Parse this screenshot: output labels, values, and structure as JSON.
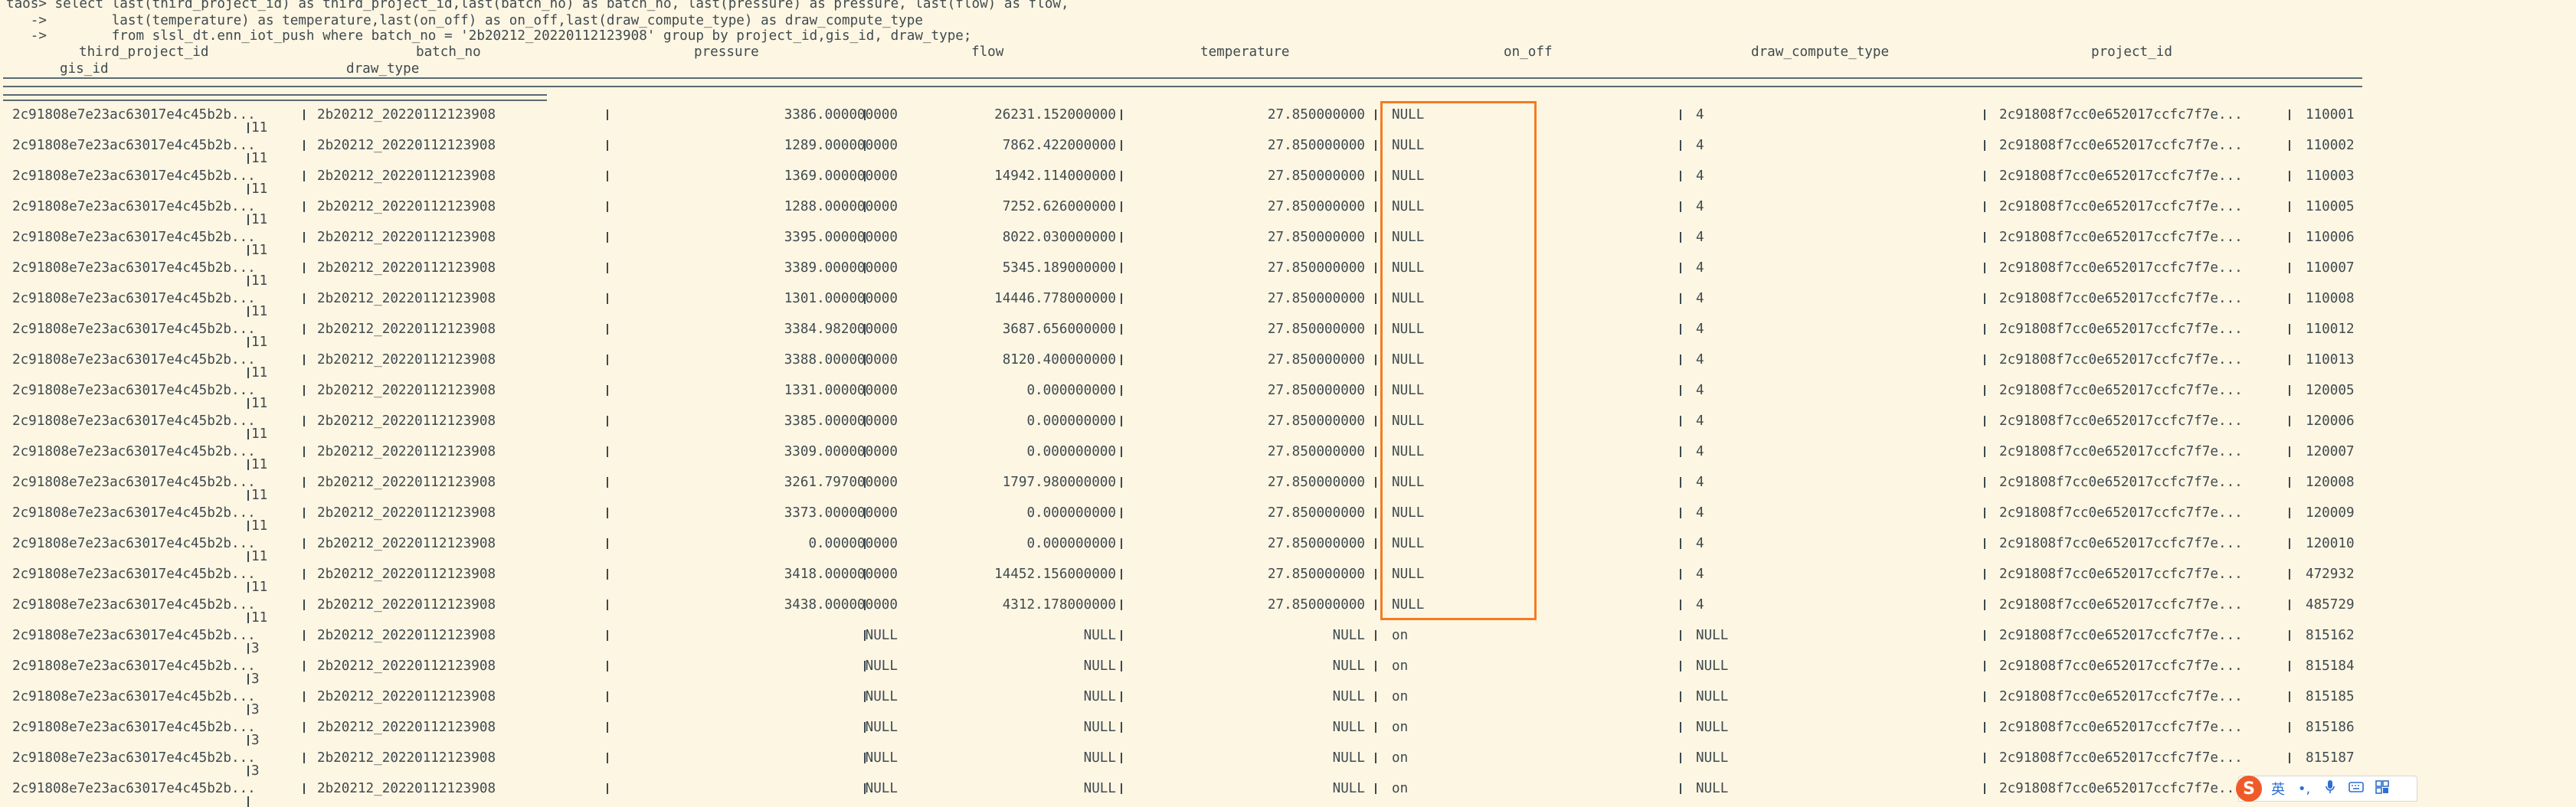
{
  "prompt": {
    "line1": "taos> select last(third_project_id) as third_project_id,last(batch_no) as batch_no, last(pressure) as pressure, last(flow) as flow,",
    "line2": "   ->        last(temperature) as temperature,last(on_off) as on_off,last(draw_compute_type) as draw_compute_type",
    "line3": "   ->        from slsl_dt.enn_iot_push where batch_no = '2b20212_20220112123908' group by project_id,gis_id, draw_type;"
  },
  "header": {
    "third_project_id": "third_project_id",
    "batch_no": "batch_no",
    "pressure": "pressure",
    "flow": "flow",
    "temperature": "temperature",
    "on_off": "on_off",
    "draw_compute_type": "draw_compute_type",
    "project_id": "project_id",
    "gis_id": "gis_id",
    "draw_type": "draw_type"
  },
  "rows": [
    {
      "third_project_id": "2c91808e7e23ac63017e4c45b2b...",
      "batch_no": "2b20212_20220112123908",
      "pressure": "3386.000000000",
      "flow": "26231.152000000",
      "temperature": "27.850000000",
      "on_off": "NULL",
      "draw_compute_type": "4",
      "project_id": "2c91808f7cc0e652017ccfc7f7e...",
      "gis_id": "110001",
      "draw_type": "11"
    },
    {
      "third_project_id": "2c91808e7e23ac63017e4c45b2b...",
      "batch_no": "2b20212_20220112123908",
      "pressure": "1289.000000000",
      "flow": "7862.422000000",
      "temperature": "27.850000000",
      "on_off": "NULL",
      "draw_compute_type": "4",
      "project_id": "2c91808f7cc0e652017ccfc7f7e...",
      "gis_id": "110002",
      "draw_type": "11"
    },
    {
      "third_project_id": "2c91808e7e23ac63017e4c45b2b...",
      "batch_no": "2b20212_20220112123908",
      "pressure": "1369.000000000",
      "flow": "14942.114000000",
      "temperature": "27.850000000",
      "on_off": "NULL",
      "draw_compute_type": "4",
      "project_id": "2c91808f7cc0e652017ccfc7f7e...",
      "gis_id": "110003",
      "draw_type": "11"
    },
    {
      "third_project_id": "2c91808e7e23ac63017e4c45b2b...",
      "batch_no": "2b20212_20220112123908",
      "pressure": "1288.000000000",
      "flow": "7252.626000000",
      "temperature": "27.850000000",
      "on_off": "NULL",
      "draw_compute_type": "4",
      "project_id": "2c91808f7cc0e652017ccfc7f7e...",
      "gis_id": "110005",
      "draw_type": "11"
    },
    {
      "third_project_id": "2c91808e7e23ac63017e4c45b2b...",
      "batch_no": "2b20212_20220112123908",
      "pressure": "3395.000000000",
      "flow": "8022.030000000",
      "temperature": "27.850000000",
      "on_off": "NULL",
      "draw_compute_type": "4",
      "project_id": "2c91808f7cc0e652017ccfc7f7e...",
      "gis_id": "110006",
      "draw_type": "11"
    },
    {
      "third_project_id": "2c91808e7e23ac63017e4c45b2b...",
      "batch_no": "2b20212_20220112123908",
      "pressure": "3389.000000000",
      "flow": "5345.189000000",
      "temperature": "27.850000000",
      "on_off": "NULL",
      "draw_compute_type": "4",
      "project_id": "2c91808f7cc0e652017ccfc7f7e...",
      "gis_id": "110007",
      "draw_type": "11"
    },
    {
      "third_project_id": "2c91808e7e23ac63017e4c45b2b...",
      "batch_no": "2b20212_20220112123908",
      "pressure": "1301.000000000",
      "flow": "14446.778000000",
      "temperature": "27.850000000",
      "on_off": "NULL",
      "draw_compute_type": "4",
      "project_id": "2c91808f7cc0e652017ccfc7f7e...",
      "gis_id": "110008",
      "draw_type": "11"
    },
    {
      "third_project_id": "2c91808e7e23ac63017e4c45b2b...",
      "batch_no": "2b20212_20220112123908",
      "pressure": "3384.982000000",
      "flow": "3687.656000000",
      "temperature": "27.850000000",
      "on_off": "NULL",
      "draw_compute_type": "4",
      "project_id": "2c91808f7cc0e652017ccfc7f7e...",
      "gis_id": "110012",
      "draw_type": "11"
    },
    {
      "third_project_id": "2c91808e7e23ac63017e4c45b2b...",
      "batch_no": "2b20212_20220112123908",
      "pressure": "3388.000000000",
      "flow": "8120.400000000",
      "temperature": "27.850000000",
      "on_off": "NULL",
      "draw_compute_type": "4",
      "project_id": "2c91808f7cc0e652017ccfc7f7e...",
      "gis_id": "110013",
      "draw_type": "11"
    },
    {
      "third_project_id": "2c91808e7e23ac63017e4c45b2b...",
      "batch_no": "2b20212_20220112123908",
      "pressure": "1331.000000000",
      "flow": "0.000000000",
      "temperature": "27.850000000",
      "on_off": "NULL",
      "draw_compute_type": "4",
      "project_id": "2c91808f7cc0e652017ccfc7f7e...",
      "gis_id": "120005",
      "draw_type": "11"
    },
    {
      "third_project_id": "2c91808e7e23ac63017e4c45b2b...",
      "batch_no": "2b20212_20220112123908",
      "pressure": "3385.000000000",
      "flow": "0.000000000",
      "temperature": "27.850000000",
      "on_off": "NULL",
      "draw_compute_type": "4",
      "project_id": "2c91808f7cc0e652017ccfc7f7e...",
      "gis_id": "120006",
      "draw_type": "11"
    },
    {
      "third_project_id": "2c91808e7e23ac63017e4c45b2b...",
      "batch_no": "2b20212_20220112123908",
      "pressure": "3309.000000000",
      "flow": "0.000000000",
      "temperature": "27.850000000",
      "on_off": "NULL",
      "draw_compute_type": "4",
      "project_id": "2c91808f7cc0e652017ccfc7f7e...",
      "gis_id": "120007",
      "draw_type": "11"
    },
    {
      "third_project_id": "2c91808e7e23ac63017e4c45b2b...",
      "batch_no": "2b20212_20220112123908",
      "pressure": "3261.797000000",
      "flow": "1797.980000000",
      "temperature": "27.850000000",
      "on_off": "NULL",
      "draw_compute_type": "4",
      "project_id": "2c91808f7cc0e652017ccfc7f7e...",
      "gis_id": "120008",
      "draw_type": "11"
    },
    {
      "third_project_id": "2c91808e7e23ac63017e4c45b2b...",
      "batch_no": "2b20212_20220112123908",
      "pressure": "3373.000000000",
      "flow": "0.000000000",
      "temperature": "27.850000000",
      "on_off": "NULL",
      "draw_compute_type": "4",
      "project_id": "2c91808f7cc0e652017ccfc7f7e...",
      "gis_id": "120009",
      "draw_type": "11"
    },
    {
      "third_project_id": "2c91808e7e23ac63017e4c45b2b...",
      "batch_no": "2b20212_20220112123908",
      "pressure": "0.000000000",
      "flow": "0.000000000",
      "temperature": "27.850000000",
      "on_off": "NULL",
      "draw_compute_type": "4",
      "project_id": "2c91808f7cc0e652017ccfc7f7e...",
      "gis_id": "120010",
      "draw_type": "11"
    },
    {
      "third_project_id": "2c91808e7e23ac63017e4c45b2b...",
      "batch_no": "2b20212_20220112123908",
      "pressure": "3418.000000000",
      "flow": "14452.156000000",
      "temperature": "27.850000000",
      "on_off": "NULL",
      "draw_compute_type": "4",
      "project_id": "2c91808f7cc0e652017ccfc7f7e...",
      "gis_id": "472932",
      "draw_type": "11"
    },
    {
      "third_project_id": "2c91808e7e23ac63017e4c45b2b...",
      "batch_no": "2b20212_20220112123908",
      "pressure": "3438.000000000",
      "flow": "4312.178000000",
      "temperature": "27.850000000",
      "on_off": "NULL",
      "draw_compute_type": "4",
      "project_id": "2c91808f7cc0e652017ccfc7f7e...",
      "gis_id": "485729",
      "draw_type": "11"
    },
    {
      "third_project_id": "2c91808e7e23ac63017e4c45b2b...",
      "batch_no": "2b20212_20220112123908",
      "pressure": "NULL",
      "flow": "NULL",
      "temperature": "NULL",
      "on_off": "on",
      "draw_compute_type": "NULL",
      "project_id": "2c91808f7cc0e652017ccfc7f7e...",
      "gis_id": "815162",
      "draw_type": "3"
    },
    {
      "third_project_id": "2c91808e7e23ac63017e4c45b2b...",
      "batch_no": "2b20212_20220112123908",
      "pressure": "NULL",
      "flow": "NULL",
      "temperature": "NULL",
      "on_off": "on",
      "draw_compute_type": "NULL",
      "project_id": "2c91808f7cc0e652017ccfc7f7e...",
      "gis_id": "815184",
      "draw_type": "3"
    },
    {
      "third_project_id": "2c91808e7e23ac63017e4c45b2b...",
      "batch_no": "2b20212_20220112123908",
      "pressure": "NULL",
      "flow": "NULL",
      "temperature": "NULL",
      "on_off": "on",
      "draw_compute_type": "NULL",
      "project_id": "2c91808f7cc0e652017ccfc7f7e...",
      "gis_id": "815185",
      "draw_type": "3"
    },
    {
      "third_project_id": "2c91808e7e23ac63017e4c45b2b...",
      "batch_no": "2b20212_20220112123908",
      "pressure": "NULL",
      "flow": "NULL",
      "temperature": "NULL",
      "on_off": "on",
      "draw_compute_type": "NULL",
      "project_id": "2c91808f7cc0e652017ccfc7f7e...",
      "gis_id": "815186",
      "draw_type": "3"
    },
    {
      "third_project_id": "2c91808e7e23ac63017e4c45b2b...",
      "batch_no": "2b20212_20220112123908",
      "pressure": "NULL",
      "flow": "NULL",
      "temperature": "NULL",
      "on_off": "on",
      "draw_compute_type": "NULL",
      "project_id": "2c91808f7cc0e652017ccfc7f7e...",
      "gis_id": "815187",
      "draw_type": "3"
    },
    {
      "third_project_id": "2c91808e7e23ac63017e4c45b2b...",
      "batch_no": "2b20212_20220112123908",
      "pressure": "NULL",
      "flow": "NULL",
      "temperature": "NULL",
      "on_off": "on",
      "draw_compute_type": "NULL",
      "project_id": "2c91808f7cc0e652017ccfc7f7e...",
      "gis_id": "",
      "draw_type": ""
    }
  ],
  "ime": {
    "logo": "S",
    "lang": "英",
    "punct": "•,",
    "mic_icon": "microphone-icon",
    "keyboard_icon": "keyboard-icon",
    "menu_icon": "toolbox-icon"
  },
  "colors": {
    "background": "#fdf6e3",
    "text": "#3f4a50",
    "highlight": "#f47c20",
    "ime_logo": "#f05a28"
  }
}
